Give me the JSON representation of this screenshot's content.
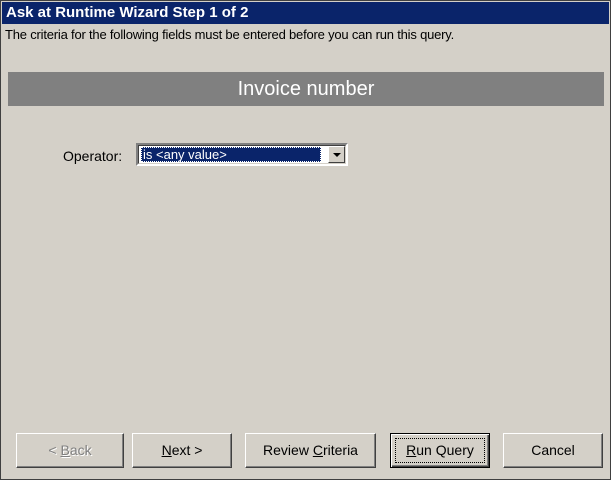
{
  "window": {
    "title": "Ask at Runtime Wizard Step 1 of 2"
  },
  "instructions": "The criteria for the following fields must be entered before you can run this query.",
  "field_header": "Invoice number",
  "operator": {
    "label": "Operator:",
    "selected_value": "is <any value>",
    "dropdown_icon": "chevron-down-icon"
  },
  "buttons": {
    "back": {
      "mnemonic": "B",
      "prefix": "< ",
      "rest": "ack"
    },
    "next": {
      "mnemonic": "N",
      "rest": "ext >"
    },
    "review": {
      "prefix": "Review ",
      "mnemonic": "C",
      "rest": "riteria"
    },
    "run": {
      "mnemonic": "R",
      "rest": "un Query"
    },
    "cancel": "Cancel"
  },
  "colors": {
    "titlebar": "#0a246a",
    "face": "#d4d0c8",
    "header_band": "#808080"
  }
}
